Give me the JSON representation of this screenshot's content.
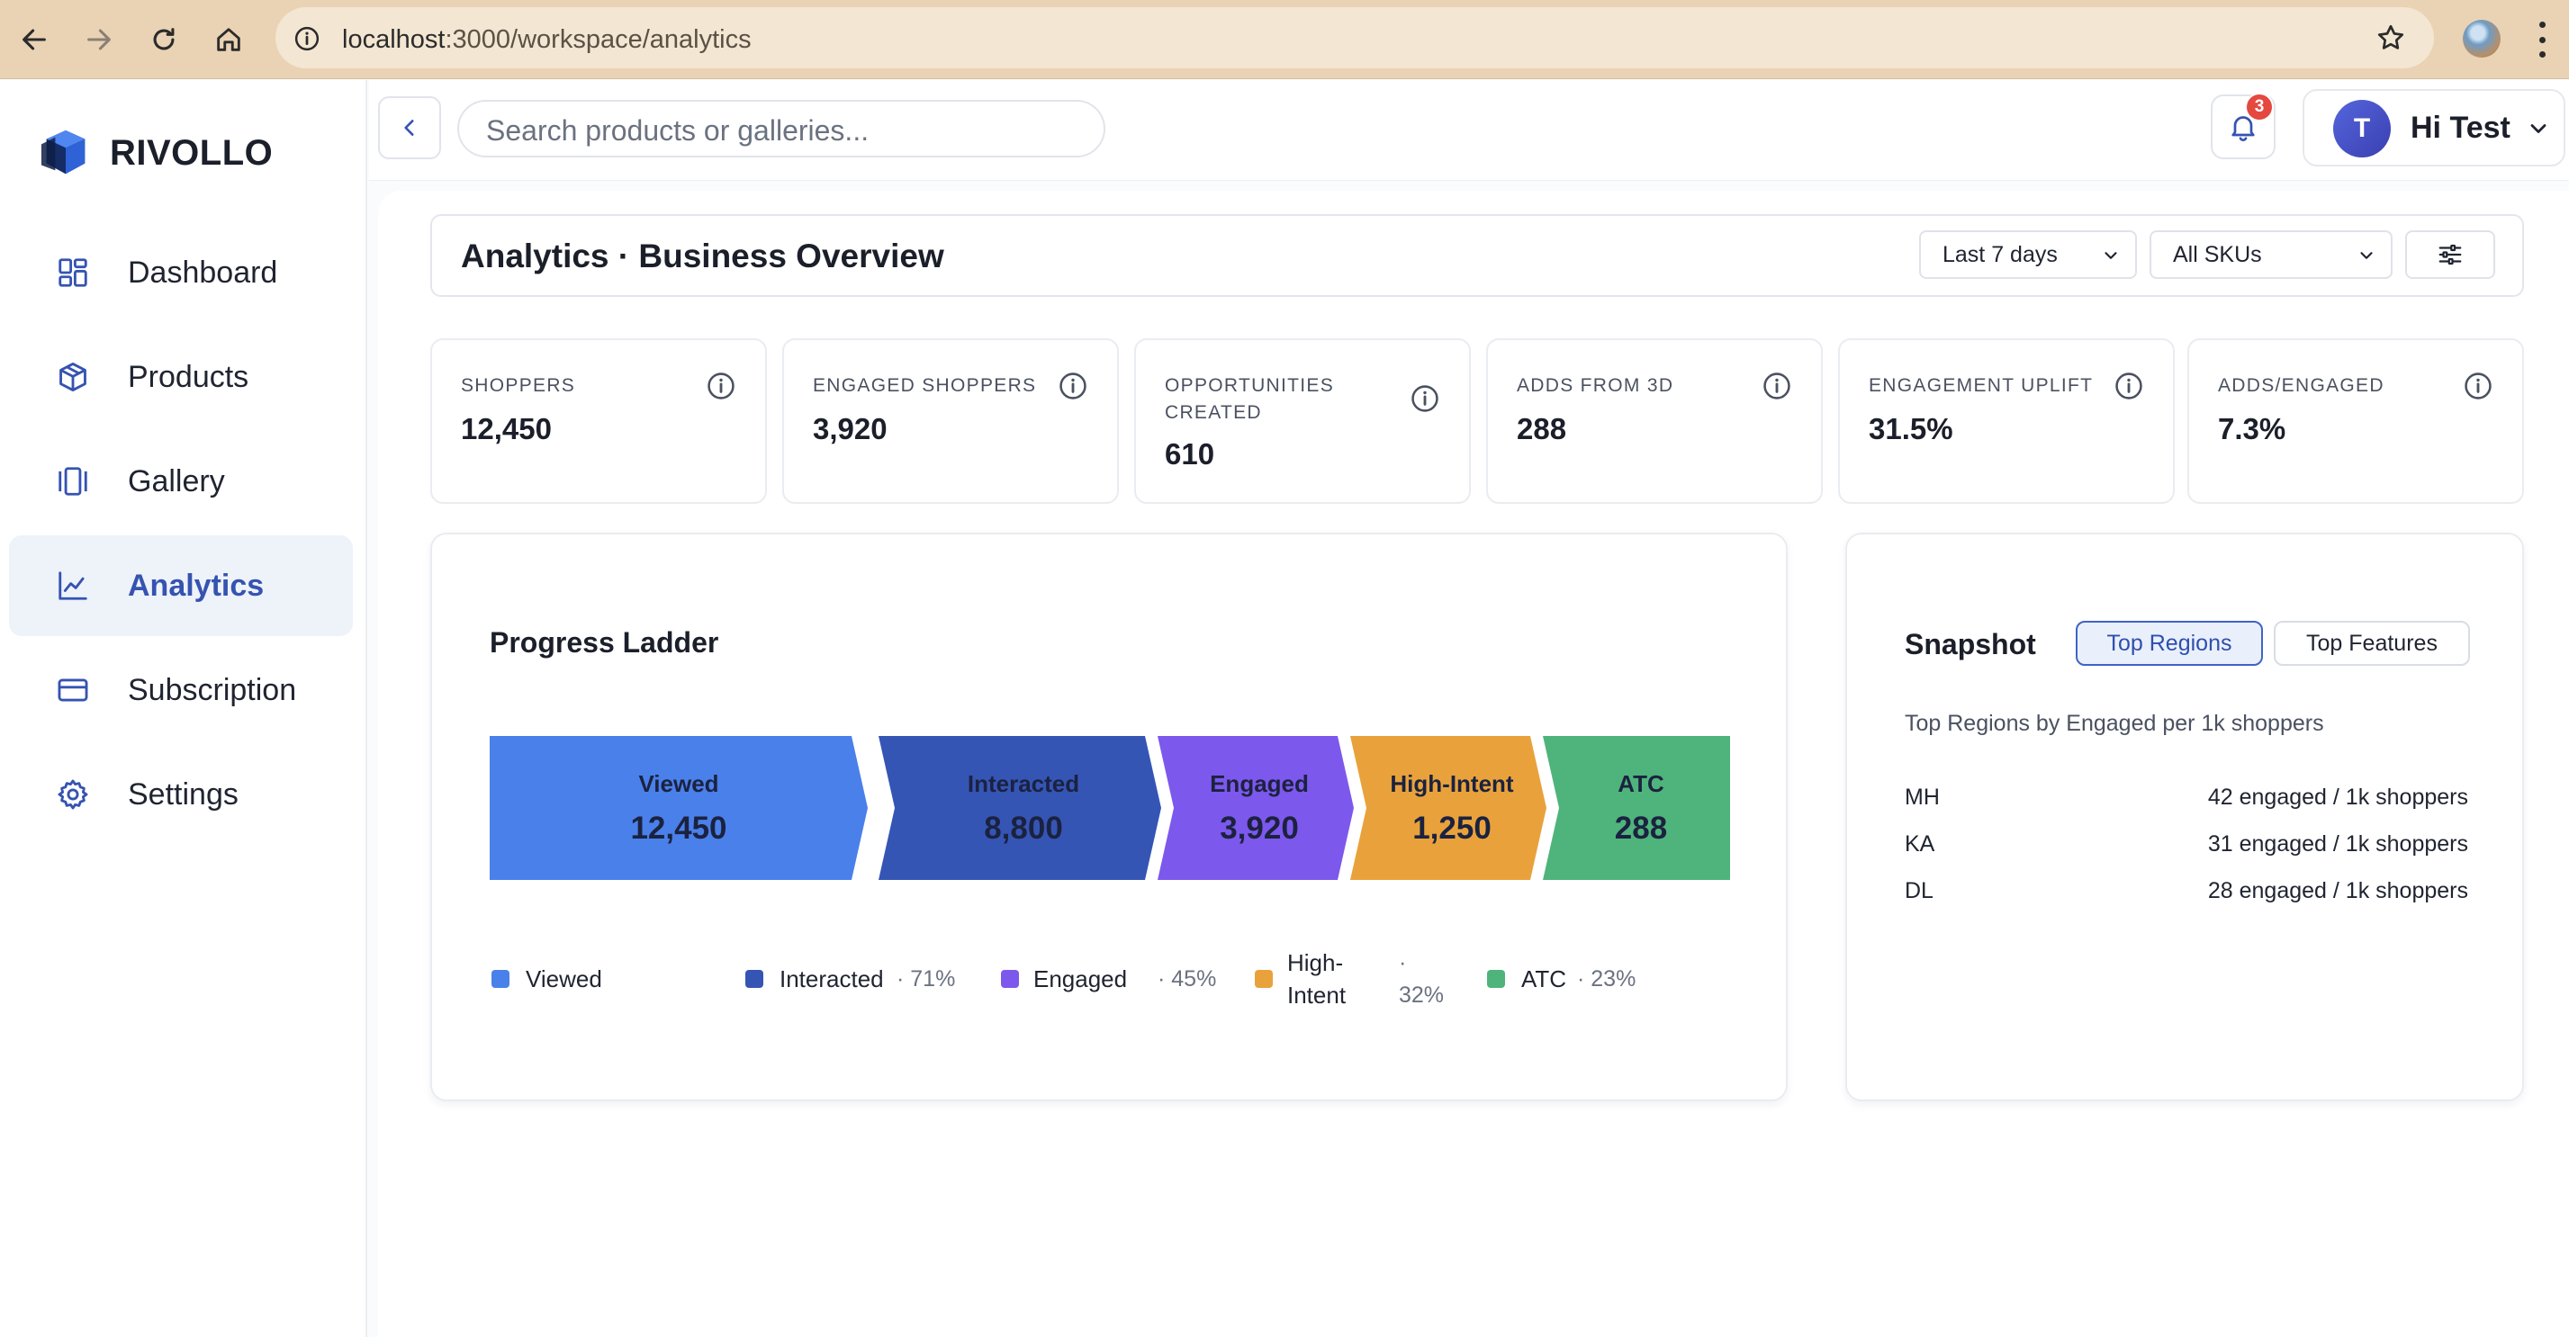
{
  "browser": {
    "url_host": "localhost",
    "url_path": ":3000/workspace/analytics"
  },
  "brand": {
    "name": "RIVOLLO"
  },
  "sidebar": {
    "items": [
      {
        "label": "Dashboard",
        "icon": "dashboard-icon",
        "active": false
      },
      {
        "label": "Products",
        "icon": "box-icon",
        "active": false
      },
      {
        "label": "Gallery",
        "icon": "gallery-icon",
        "active": false
      },
      {
        "label": "Analytics",
        "icon": "chart-line-icon",
        "active": true
      },
      {
        "label": "Subscription",
        "icon": "card-icon",
        "active": false
      },
      {
        "label": "Settings",
        "icon": "gear-icon",
        "active": false
      }
    ]
  },
  "topbar": {
    "search_placeholder": "Search products or galleries...",
    "notification_count": "3",
    "user_initial": "T",
    "user_greeting": "Hi Test"
  },
  "header": {
    "title": "Analytics · Business Overview",
    "range_select": "Last 7 days",
    "sku_select": "All SKUs"
  },
  "kpis": [
    {
      "label": "SHOPPERS",
      "value": "12,450"
    },
    {
      "label": "ENGAGED SHOPPERS",
      "value": "3,920"
    },
    {
      "label": "OPPORTUNITIES CREATED",
      "value": "610"
    },
    {
      "label": "ADDS FROM 3D",
      "value": "288"
    },
    {
      "label": "ENGAGEMENT UPLIFT",
      "value": "31.5%"
    },
    {
      "label": "ADDS/ENGAGED",
      "value": "7.3%"
    }
  ],
  "ladder": {
    "title": "Progress Ladder",
    "steps": [
      {
        "label": "Viewed",
        "value": "12,450",
        "color": "#4a80ea",
        "text_color": "#1b2240"
      },
      {
        "label": "Interacted",
        "value": "8,800",
        "color": "#3555b5",
        "text_color": "#1b2240"
      },
      {
        "label": "Engaged",
        "value": "3,920",
        "color": "#7d58ec",
        "text_color": "#1b2240"
      },
      {
        "label": "High-Intent",
        "value": "1,250",
        "color": "#e9a23b",
        "text_color": "#1b2240"
      },
      {
        "label": "ATC",
        "value": "288",
        "color": "#4fb47b",
        "text_color": "#1b2240"
      }
    ],
    "legend": [
      {
        "name": "Viewed",
        "pct": "",
        "color": "#4a80ea"
      },
      {
        "name": "Interacted",
        "pct": "· 71%",
        "color": "#3555b5"
      },
      {
        "name": "Engaged",
        "pct": "· 45%",
        "color": "#7d58ec"
      },
      {
        "name_line1": "High-",
        "name_line2": "Intent",
        "pct_line1": "·",
        "pct_line2": "32%",
        "color": "#e9a23b"
      },
      {
        "name": "ATC",
        "pct": "· 23%",
        "color": "#4fb47b"
      }
    ]
  },
  "snapshot": {
    "title": "Snapshot",
    "tabs": [
      {
        "label": "Top Regions",
        "active": true
      },
      {
        "label": "Top Features",
        "active": false
      }
    ],
    "subtitle": "Top Regions by Engaged per 1k shoppers",
    "rows": [
      {
        "region": "MH",
        "value": "42 engaged / 1k shoppers"
      },
      {
        "region": "KA",
        "value": "31 engaged / 1k shoppers"
      },
      {
        "region": "DL",
        "value": "28 engaged / 1k shoppers"
      }
    ]
  }
}
